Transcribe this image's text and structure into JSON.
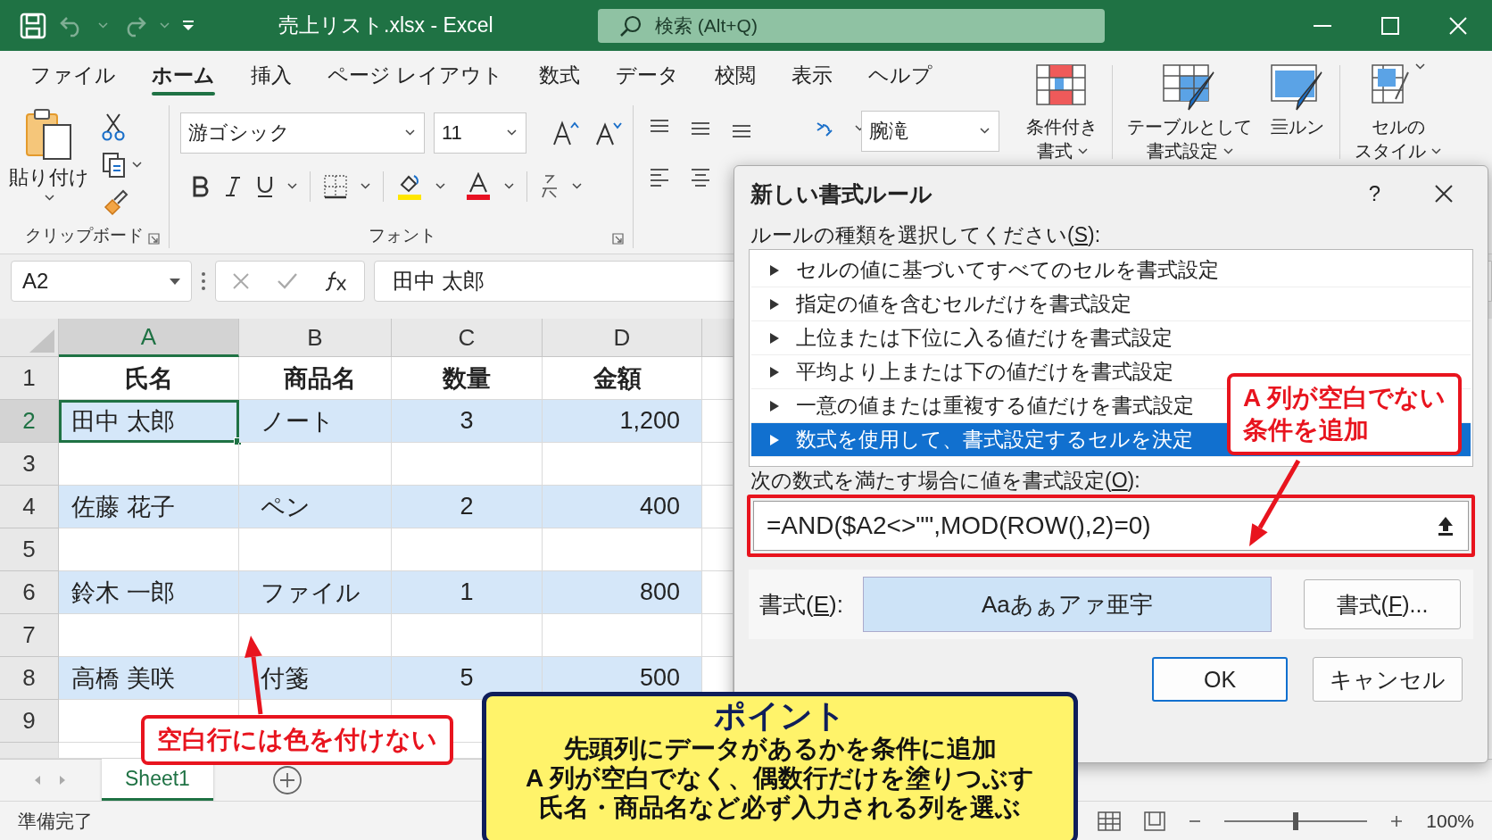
{
  "window": {
    "title": "売上リスト.xlsx - Excel",
    "search_placeholder": "検索 (Alt+Q)"
  },
  "ribbon_tabs": [
    {
      "label": "ファイル",
      "selected": false
    },
    {
      "label": "ホーム",
      "selected": true
    },
    {
      "label": "挿入",
      "selected": false
    },
    {
      "label": "ページ レイアウト",
      "selected": false
    },
    {
      "label": "数式",
      "selected": false
    },
    {
      "label": "データ",
      "selected": false
    },
    {
      "label": "校閲",
      "selected": false
    },
    {
      "label": "表示",
      "selected": false
    },
    {
      "label": "ヘルプ",
      "selected": false
    }
  ],
  "ribbon": {
    "clipboard": {
      "paste_label": "貼り付け",
      "group_label": "クリップボード"
    },
    "font": {
      "font_name": "游ゴシック",
      "font_size": "11",
      "group_label": "フォント"
    },
    "number_format": "腕滝",
    "styles": [
      {
        "kind": "conditional",
        "label_lines": [
          "条件付き",
          "書式"
        ]
      },
      {
        "kind": "table",
        "label_lines": [
          "テーブルとして",
          "書式設定"
        ]
      },
      {
        "kind": "cells",
        "label_lines": [
          "亖ルン"
        ]
      },
      {
        "kind": "cellstyle",
        "label_lines": [
          "セルの",
          "スタイル"
        ]
      }
    ]
  },
  "formula_bar": {
    "name_box": "A2",
    "content": "田中 太郎"
  },
  "sheet": {
    "columns": [
      {
        "label": "A",
        "selected": true
      },
      {
        "label": "B",
        "selected": false
      },
      {
        "label": "C",
        "selected": false
      },
      {
        "label": "D",
        "selected": false
      }
    ],
    "rows": [
      {
        "number": "1",
        "kind": "header",
        "highlighted": false,
        "selected": false,
        "cells": [
          "氏名",
          "商品名",
          "数量",
          "金額"
        ]
      },
      {
        "number": "2",
        "kind": "data",
        "highlighted": true,
        "selected": true,
        "cells": [
          "田中 太郎",
          "ノート",
          "3",
          "1,200"
        ]
      },
      {
        "number": "3",
        "kind": "data",
        "highlighted": false,
        "selected": false
      },
      {
        "number": "4",
        "kind": "data",
        "highlighted": true,
        "selected": false,
        "cells": [
          "佐藤 花子",
          "ペン",
          "2",
          "400"
        ]
      },
      {
        "number": "5",
        "kind": "data",
        "highlighted": false,
        "selected": false
      },
      {
        "number": "6",
        "kind": "data",
        "highlighted": true,
        "selected": false,
        "cells": [
          "鈴木 一郎",
          "ファイル",
          "1",
          "800"
        ]
      },
      {
        "number": "7",
        "kind": "data",
        "highlighted": false,
        "selected": false
      },
      {
        "number": "8",
        "kind": "data",
        "highlighted": true,
        "selected": false,
        "cells": [
          "高橋 美咲",
          "付箋",
          "5",
          "500"
        ]
      },
      {
        "number": "9",
        "kind": "data",
        "highlighted": false,
        "selected": false
      }
    ]
  },
  "sheet_tabs": [
    {
      "label": "Sheet1",
      "selected": true
    }
  ],
  "status_bar": {
    "text": "準備完了",
    "zoom": "100%",
    "zoom_slider": {
      "level": 0.5
    }
  },
  "dialog": {
    "title": "新しい書式ルール",
    "help": "?",
    "rule_type_label": {
      "before": "ルールの種類を選択してください(",
      "key": "S",
      "after": "):"
    },
    "rule_types": [
      {
        "label": "セルの値に基づいてすべてのセルを書式設定",
        "selected": false
      },
      {
        "label": "指定の値を含むセルだけを書式設定",
        "selected": false
      },
      {
        "label": "上位または下位に入る値だけを書式設定",
        "selected": false
      },
      {
        "label": "平均より上または下の値だけを書式設定",
        "selected": false
      },
      {
        "label": "一意の値または重複する値だけを書式設定",
        "selected": false
      },
      {
        "label": "数式を使用して、書式設定するセルを決定",
        "selected": true
      }
    ],
    "formula_label": {
      "before": "次の数式を満たす場合に値を書式設定(",
      "key": "O",
      "after": "):"
    },
    "formula": "=AND($A2<>\"\",MOD(ROW(),2)=0)",
    "formula_highlighted": true,
    "format_label": {
      "before": "書式(",
      "key": "E",
      "after": "):"
    },
    "preview": "Aaあぁアァ亜宇",
    "format_button": {
      "before": "書式(",
      "key": "F",
      "after": ")..."
    },
    "ok": "OK",
    "cancel": "キャンセル"
  },
  "annotations": [
    {
      "kind": "callout",
      "lines": [
        "A 列が空白でない",
        "条件を追加"
      ]
    },
    {
      "kind": "callout",
      "lines": [
        "空白行には色を付けない"
      ]
    },
    {
      "kind": "point",
      "title": "ポイント",
      "lines": [
        "先頭列にデータがあるかを条件に追加",
        "A 列が空白でなく、偶数行だけを塗りつぶす",
        "氏名・商品名など必ず入力される列を選ぶ"
      ]
    }
  ]
}
